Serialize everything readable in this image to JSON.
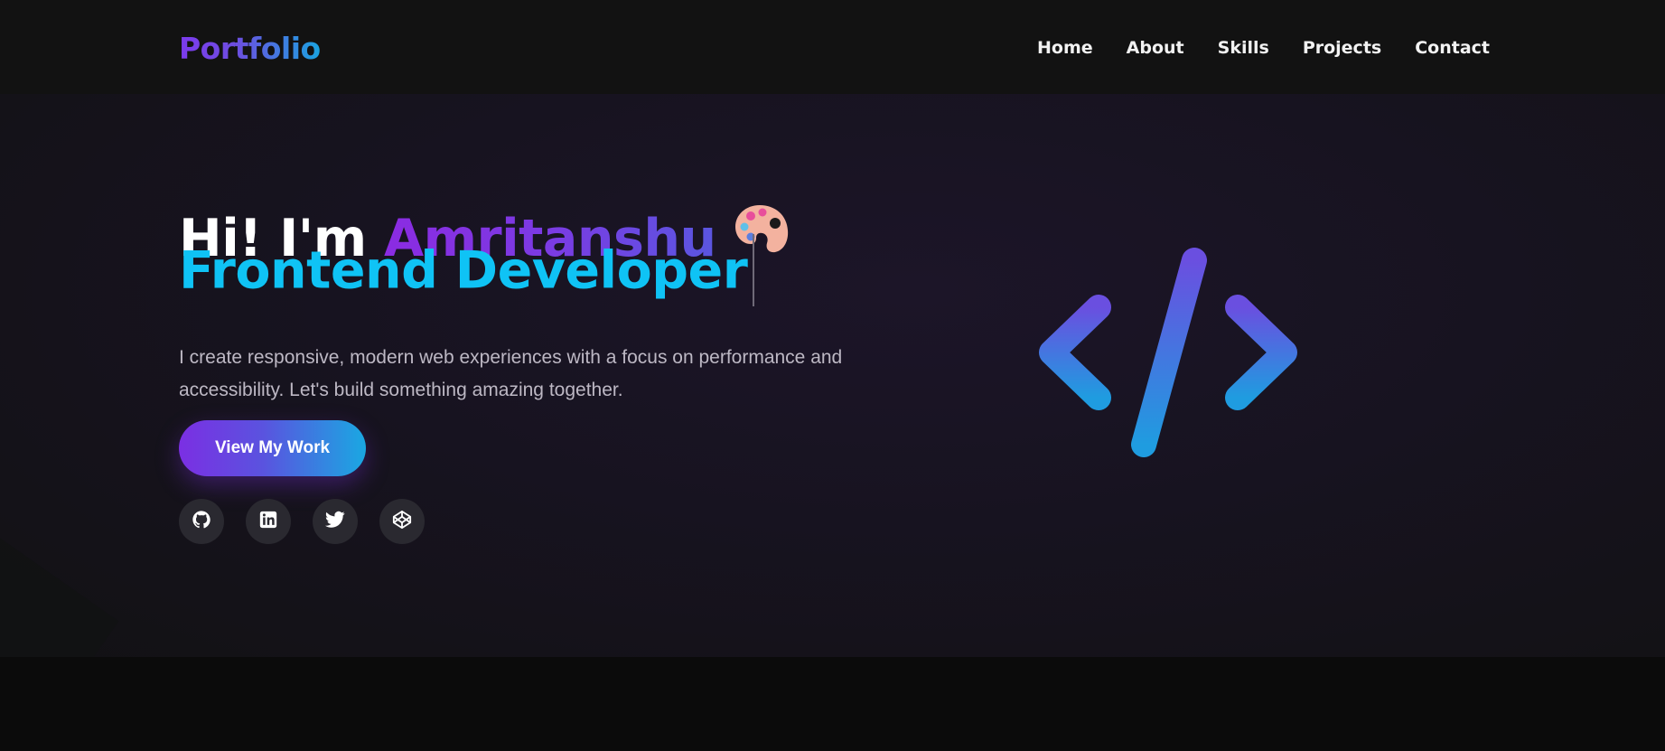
{
  "navbar": {
    "logo": "Portfolio",
    "links": [
      "Home",
      "About",
      "Skills",
      "Projects",
      "Contact"
    ]
  },
  "hero": {
    "greeting": "Hi! I'm",
    "name": "Amritanshu",
    "role": "Frontend Developer",
    "tagline": "I create responsive, modern web experiences with a focus on performance and accessibility. Let's build something amazing together.",
    "cta_label": "View My Work",
    "socials": [
      "github-icon",
      "linkedin-icon",
      "twitter-icon",
      "codepen-icon"
    ]
  },
  "colors": {
    "accent_purple": "#7c3aed",
    "accent_cyan": "#0fc3f5",
    "background": "#141218",
    "nav_background": "#121212"
  }
}
